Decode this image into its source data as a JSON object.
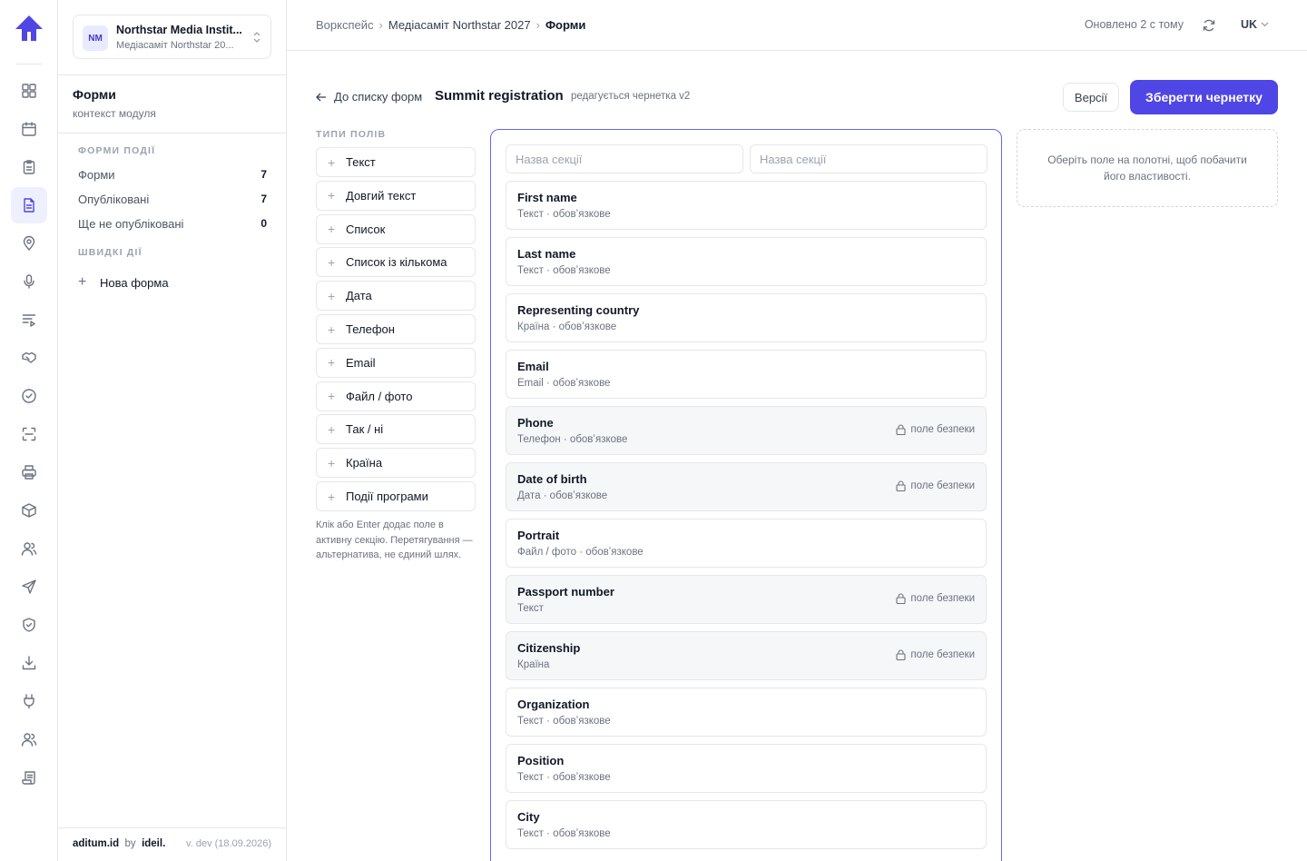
{
  "org": {
    "initials": "NM",
    "name": "Northstar Media Instit...",
    "subtitle": "Медіасаміт Northstar 20..."
  },
  "module": {
    "title": "Форми",
    "subtitle": "контекст модуля"
  },
  "sidebar": {
    "section1": "ФОРМИ ПОДІЇ",
    "items": [
      {
        "label": "Форми",
        "count": "7"
      },
      {
        "label": "Опубліковані",
        "count": "7"
      },
      {
        "label": "Ще не опубліковані",
        "count": "0"
      }
    ],
    "section2": "ШВИДКІ ДІЇ",
    "new_form": "Нова форма",
    "footer_brand": "aditum.id",
    "footer_by": "by",
    "footer_company": "ideil.",
    "footer_version": "v. dev (18.09.2026)"
  },
  "rail": {
    "icons": [
      "dashboard-icon",
      "calendar-icon",
      "clipboard-icon",
      "forms-icon",
      "location-icon",
      "microphone-icon",
      "agenda-icon",
      "handshake-icon",
      "check-circle-icon",
      "scan-icon",
      "printer-icon",
      "package-icon",
      "users-icon",
      "send-icon",
      "shield-icon",
      "download-icon",
      "plug-icon",
      "team-icon",
      "scroll-icon"
    ],
    "active_index": 3,
    "accent": "#4f46e5"
  },
  "topbar": {
    "crumbs": [
      "Воркспейс",
      "Медіасаміт Northstar 2027",
      "Форми"
    ],
    "updated": "Оновлено 2 с тому",
    "lang": "UK"
  },
  "header": {
    "back": "До списку форм",
    "form_name": "Summit registration",
    "draft": "редагується чернетка v2",
    "versions": "Версії",
    "save": "Зберегти чернетку"
  },
  "field_types": {
    "heading": "ТИПИ ПОЛІВ",
    "items": [
      "Текст",
      "Довгий текст",
      "Список",
      "Список із кількома",
      "Дата",
      "Телефон",
      "Email",
      "Файл / фото",
      "Так / ні",
      "Країна",
      "Події програми"
    ],
    "hint": "Клік або Enter додає поле в активну секцію. Перетягування — альтернатива, не єдиний шлях."
  },
  "canvas": {
    "section_placeholder": "Назва секції",
    "security_label": "поле безпеки",
    "fields": [
      {
        "label": "First name",
        "meta": "Текст · обовʼязкове",
        "security": false
      },
      {
        "label": "Last name",
        "meta": "Текст · обовʼязкове",
        "security": false
      },
      {
        "label": "Representing country",
        "meta": "Країна · обовʼязкове",
        "security": false
      },
      {
        "label": "Email",
        "meta": "Email · обовʼязкове",
        "security": false
      },
      {
        "label": "Phone",
        "meta": "Телефон · обовʼязкове",
        "security": true
      },
      {
        "label": "Date of birth",
        "meta": "Дата · обовʼязкове",
        "security": true
      },
      {
        "label": "Portrait",
        "meta": "Файл / фото · обовʼязкове",
        "security": false
      },
      {
        "label": "Passport number",
        "meta": "Текст",
        "security": true
      },
      {
        "label": "Citizenship",
        "meta": "Країна",
        "security": true
      },
      {
        "label": "Organization",
        "meta": "Текст · обовʼязкове",
        "security": false
      },
      {
        "label": "Position",
        "meta": "Текст · обовʼязкове",
        "security": false
      },
      {
        "label": "City",
        "meta": "Текст · обовʼязкове",
        "security": false
      }
    ]
  },
  "properties": {
    "empty": "Оберіть поле на полотні, щоб побачити його властивості."
  }
}
